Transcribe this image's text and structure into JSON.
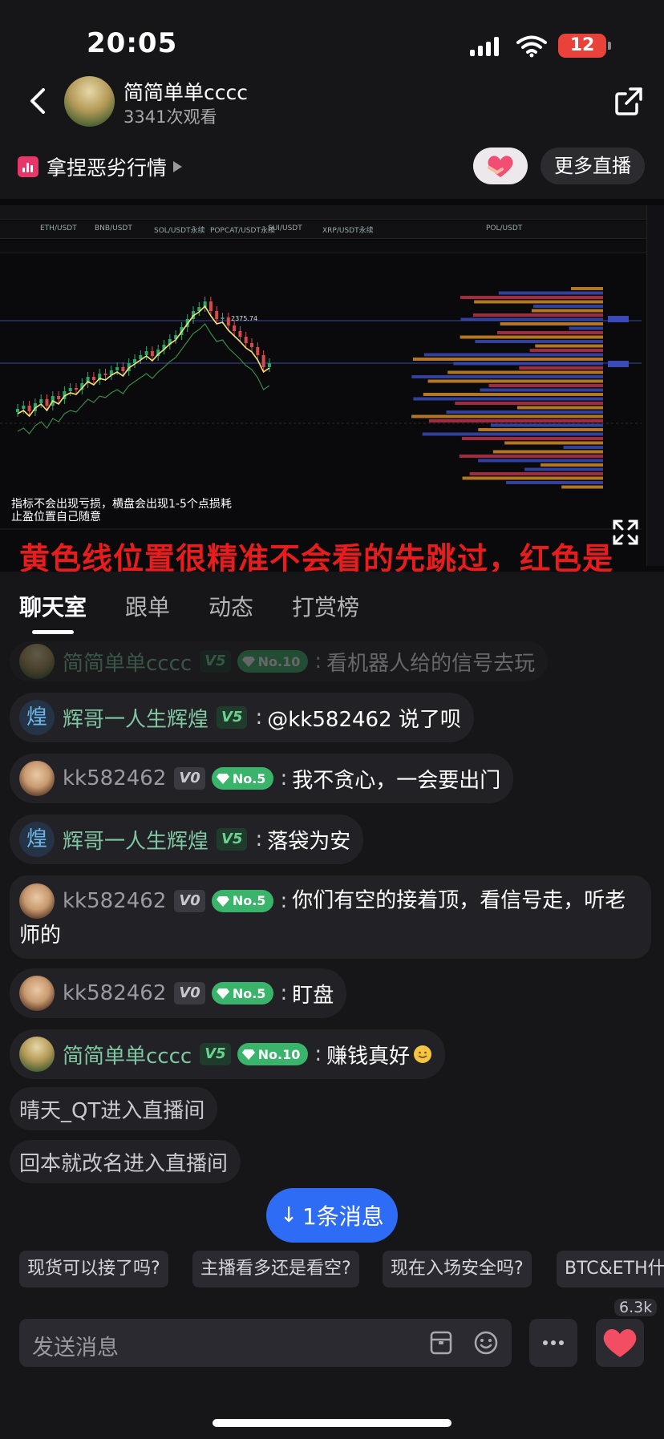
{
  "status_bar": {
    "time": "20:05",
    "battery": "12"
  },
  "header": {
    "host_name": "简简单单cccc",
    "views": "3341次观看"
  },
  "topic": {
    "label": "拿捏恶劣行情"
  },
  "buttons": {
    "more_live": "更多直播"
  },
  "video": {
    "overlay_line1": "指标不会出现亏损，横盘会出现1-5个点损耗",
    "overlay_line2": "止盈位置自己随意",
    "danmaku": "黄色线位置很精准不会看的先跳过，红色是",
    "chart_tabs": [
      "ETH/USDT",
      "BNB/USDT",
      "SOL/USDT永续",
      "POPCAT/USDT永续",
      "SUI/USDT",
      "XRP/USDT永续",
      "POL/USDT"
    ],
    "peak_label": "2375.74"
  },
  "tabs": [
    "聊天室",
    "跟单",
    "动态",
    "打赏榜"
  ],
  "chat": [
    {
      "user": "简简单单cccc",
      "level": "V5",
      "rank": "No.10",
      "text": "看机器人给的信号去玩"
    },
    {
      "user": "辉哥一人生辉煌",
      "avatar_char": "煌",
      "level": "V5",
      "text": "@kk582462 说了呗"
    },
    {
      "user": "kk582462",
      "level": "V0",
      "rank": "No.5",
      "text": "我不贪心，一会要出门"
    },
    {
      "user": "辉哥一人生辉煌",
      "avatar_char": "煌",
      "level": "V5",
      "text": "落袋为安"
    },
    {
      "user": "kk582462",
      "level": "V0",
      "rank": "No.5",
      "text": "你们有空的接着顶，看信号走，听老师的"
    },
    {
      "user": "kk582462",
      "level": "V0",
      "rank": "No.5",
      "text": "盯盘"
    },
    {
      "user": "简简单单cccc",
      "level": "V5",
      "rank": "No.10",
      "text": "赚钱真好"
    },
    {
      "system": "晴天_QT进入直播间"
    },
    {
      "system": "回本就改名进入直播间"
    }
  ],
  "new_messages": "1条消息",
  "quick_replies": [
    "现货可以接了吗?",
    "主播看多还是看空?",
    "现在入场安全吗?",
    "BTC&ETH什"
  ],
  "input": {
    "placeholder": "发送消息"
  },
  "like_count": "6.3k",
  "colors": {
    "accent_blue": "#2f6cf6",
    "username_green": "#7fc7a0",
    "rank_green": "#39b46a",
    "danmaku_red": "#e81c1c"
  }
}
